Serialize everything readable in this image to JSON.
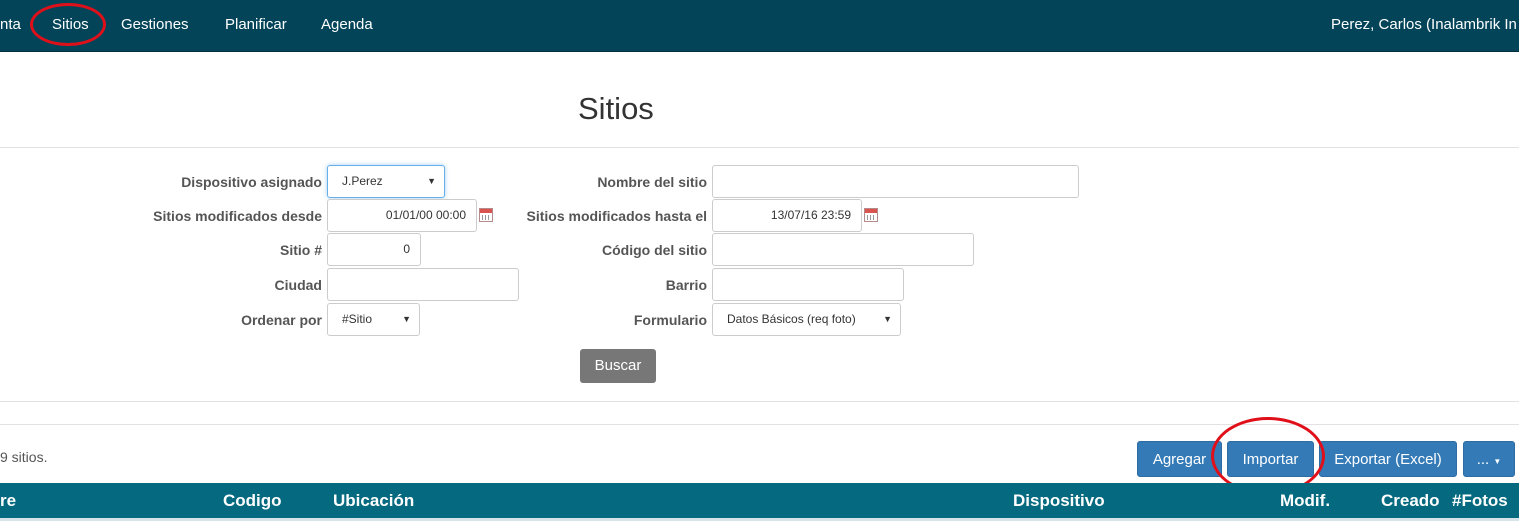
{
  "navbar": {
    "items": [
      "nta",
      "Sitios",
      "Gestiones",
      "Planificar",
      "Agenda"
    ],
    "user": "Perez, Carlos (Inalambrik In"
  },
  "page": {
    "title": "Sitios"
  },
  "filters": {
    "dispositivo_label": "Dispositivo asignado",
    "dispositivo_value": "J.Perez",
    "desde_label": "Sitios modificados desde",
    "desde_value": "01/01/00 00:00",
    "sitio_num_label": "Sitio #",
    "sitio_num_value": "0",
    "ciudad_label": "Ciudad",
    "ciudad_value": "",
    "ordenar_label": "Ordenar por",
    "ordenar_value": "#Sitio",
    "nombre_label": "Nombre del sitio",
    "nombre_value": "",
    "hasta_label": "Sitios modificados hasta el",
    "hasta_value": "13/07/16 23:59",
    "codigo_label": "Código del sitio",
    "codigo_value": "",
    "barrio_label": "Barrio",
    "barrio_value": "",
    "formulario_label": "Formulario",
    "formulario_value": "Datos Básicos (req foto)",
    "buscar_label": "Buscar"
  },
  "results": {
    "count_text": "9 sitios.",
    "buttons": {
      "agregar": "Agregar",
      "importar": "Importar",
      "exportar": "Exportar (Excel)",
      "more": "..."
    }
  },
  "table": {
    "headers": [
      "re",
      "Codigo",
      "Ubicación",
      "Dispositivo",
      "Modif.",
      "Creado",
      "#Fotos"
    ]
  },
  "colors": {
    "navbar": "#034459",
    "table_header": "#05697f",
    "primary": "#337ab7",
    "annotation": "#e0101a"
  },
  "icons": [
    "calendar-icon",
    "caret-down-icon"
  ]
}
